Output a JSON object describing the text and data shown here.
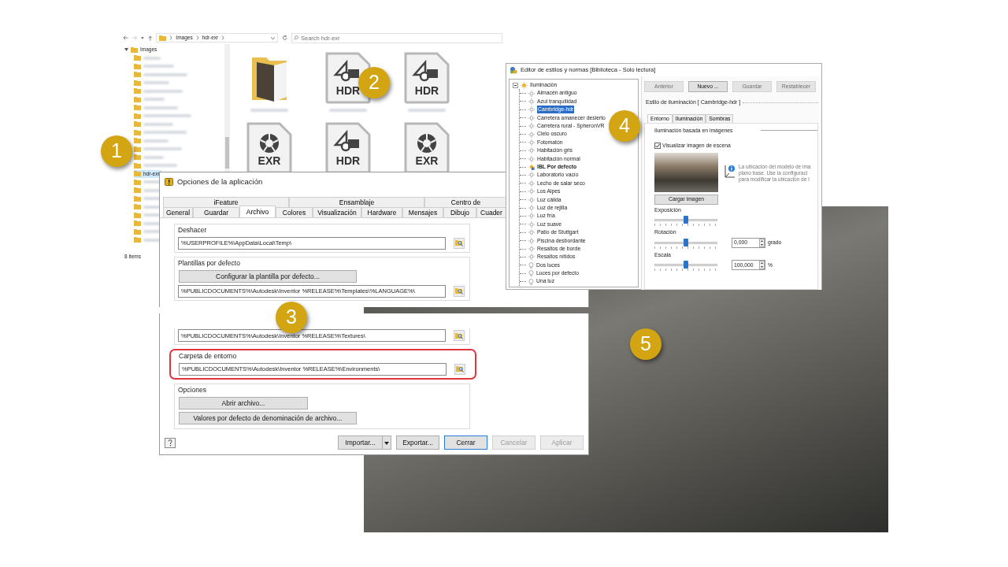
{
  "callouts": [
    "1",
    "2",
    "3",
    "4",
    "5"
  ],
  "explorer": {
    "breadcrumb": [
      "Images",
      "hdr-exr"
    ],
    "search": {
      "placeholder": "Search hdr-exr"
    },
    "tree": [
      {
        "label": "Images",
        "expanded": true,
        "children": [
          {
            "blurred": true,
            "selected": false
          },
          {
            "blurred": true,
            "selected": false
          },
          {
            "blurred": true,
            "selected": false
          },
          {
            "blurred": true,
            "selected": false
          },
          {
            "blurred": true,
            "selected": false
          },
          {
            "blurred": true,
            "selected": false
          },
          {
            "blurred": true,
            "selected": false
          },
          {
            "blurred": true,
            "selected": false
          },
          {
            "blurred": true,
            "selected": false
          },
          {
            "blurred": true,
            "selected": false
          },
          {
            "blurred": true,
            "selected": false
          },
          {
            "blurred": true,
            "selected": false
          },
          {
            "blurred": true,
            "selected": false
          },
          {
            "blurred": true,
            "selected": false
          },
          {
            "label": "hdr-exr",
            "blurred": false,
            "selected": true
          },
          {
            "blurred": true,
            "selected": false
          },
          {
            "blurred": true,
            "selected": false
          },
          {
            "blurred": true,
            "selected": false
          },
          {
            "blurred": true,
            "selected": false
          },
          {
            "blurred": true,
            "selected": false
          },
          {
            "blurred": true,
            "selected": false
          },
          {
            "blurred": true,
            "selected": false
          },
          {
            "blurred": true,
            "selected": false
          }
        ]
      }
    ],
    "status": "8 items",
    "files": [
      {
        "kind": "folder"
      },
      {
        "kind": "hdr",
        "label": "HDR"
      },
      {
        "kind": "hdr",
        "label": "HDR"
      },
      {
        "kind": "exr",
        "label": "EXR"
      },
      {
        "kind": "hdr",
        "label": "HDR"
      },
      {
        "kind": "exr",
        "label": "EXR"
      }
    ]
  },
  "options": {
    "title": "Opciones de la aplicación",
    "tab_rows": [
      [
        {
          "label": "iFeature",
          "selected": false
        },
        {
          "label": "Ensamblaje",
          "selected": false
        },
        {
          "label": "Centro de",
          "selected": false
        }
      ],
      [
        {
          "label": "General",
          "selected": false
        },
        {
          "label": "Guardar",
          "selected": false
        },
        {
          "label": "Archivo",
          "selected": true
        },
        {
          "label": "Colores",
          "selected": false
        },
        {
          "label": "Visualización",
          "selected": false
        },
        {
          "label": "Hardware",
          "selected": false
        },
        {
          "label": "Mensajes",
          "selected": false
        },
        {
          "label": "Dibujo",
          "selected": false
        },
        {
          "label": "Cuader",
          "selected": false
        }
      ]
    ],
    "upper_groups": [
      {
        "label": "Deshacer",
        "highlighted": false,
        "items": [
          {
            "kind": "path",
            "value": "%USERPROFILE%\\AppData\\Local\\Temp\\"
          }
        ]
      },
      {
        "label": "Plantillas por defecto",
        "highlighted": false,
        "items": [
          {
            "kind": "button",
            "label": "Configurar la plantilla por defecto..."
          },
          {
            "kind": "path",
            "value": "%PUBLICDOCUMENTS%\\Autodesk\\Inventor %RELEASE%\\Templates\\%LANGUAGE%\\"
          }
        ]
      }
    ],
    "lower_groups": [
      {
        "highlighted": false,
        "items": [
          {
            "kind": "path",
            "value": "%PUBLICDOCUMENTS%\\Autodesk\\Inventor %RELEASE%\\Textures\\"
          }
        ]
      },
      {
        "label": "Carpeta de entorno",
        "highlighted": true,
        "items": [
          {
            "kind": "path",
            "value": "%PUBLICDOCUMENTS%\\Autodesk\\Inventor %RELEASE%\\Environments\\"
          }
        ]
      },
      {
        "label": "Opciones",
        "highlighted": false,
        "items": [
          {
            "kind": "button",
            "label": "Abrir archivo..."
          },
          {
            "kind": "button",
            "label": "Valores por defecto de denominación de archivo..."
          }
        ]
      }
    ],
    "footer": [
      {
        "label": "Importar...",
        "kind": "split",
        "disabled": false,
        "default": false
      },
      {
        "label": "Exportar...",
        "kind": "plain",
        "disabled": false,
        "default": false
      },
      {
        "label": "Cerrar",
        "kind": "plain",
        "disabled": false,
        "default": true
      },
      {
        "label": "Cancelar",
        "kind": "plain",
        "disabled": true,
        "default": false
      },
      {
        "label": "Aplicar",
        "kind": "plain",
        "disabled": true,
        "default": false
      }
    ]
  },
  "editor": {
    "title": "Editor de estilos y normas [Biblioteca - Solo lectura]",
    "tree": {
      "label": "Iluminación",
      "expanded": true,
      "children": [
        {
          "label": "Almacén antiguo",
          "kind": "environment",
          "selected": false
        },
        {
          "label": "Azul tranquilidad",
          "kind": "environment",
          "selected": false
        },
        {
          "label": "Cambridge-hdr",
          "kind": "environment",
          "selected": true
        },
        {
          "label": "Carretera amanecer desierto",
          "kind": "environment",
          "selected": false
        },
        {
          "label": "Carretera rural - SpheronVR",
          "kind": "environment",
          "selected": false
        },
        {
          "label": "Cielo oscuro",
          "kind": "environment",
          "selected": false
        },
        {
          "label": "Fotomatón",
          "kind": "environment",
          "selected": false
        },
        {
          "label": "Habitación gris",
          "kind": "environment",
          "selected": false
        },
        {
          "label": "Habitación normal",
          "kind": "environment",
          "selected": false
        },
        {
          "label": "IBL Por defecto",
          "kind": "default",
          "selected": false
        },
        {
          "label": "Laboratorio vacío",
          "kind": "environment",
          "selected": false
        },
        {
          "label": "Lecho de salar seco",
          "kind": "environment",
          "selected": false
        },
        {
          "label": "Los Alpes",
          "kind": "environment",
          "selected": false
        },
        {
          "label": "Luz cálida",
          "kind": "environment",
          "selected": false
        },
        {
          "label": "Luz de rejilla",
          "kind": "environment",
          "selected": false
        },
        {
          "label": "Luz fría",
          "kind": "environment",
          "selected": false
        },
        {
          "label": "Luz suave",
          "kind": "environment",
          "selected": false
        },
        {
          "label": "Patio de Stuttgart",
          "kind": "environment",
          "selected": false
        },
        {
          "label": "Piscina desbordante",
          "kind": "environment",
          "selected": false
        },
        {
          "label": "Resaltos de borde",
          "kind": "environment",
          "selected": false
        },
        {
          "label": "Resaltos nítidos",
          "kind": "environment",
          "selected": false
        },
        {
          "label": "Dos luces",
          "kind": "light",
          "selected": false
        },
        {
          "label": "Luces por defecto",
          "kind": "light",
          "selected": false
        },
        {
          "label": "Una luz",
          "kind": "light",
          "selected": false
        }
      ]
    },
    "buttons": [
      {
        "label": "Anterior",
        "disabled": true
      },
      {
        "label": "Nuevo ...",
        "disabled": false
      },
      {
        "label": "Guardar",
        "disabled": true
      },
      {
        "label": "Restablecer",
        "disabled": true
      }
    ],
    "style_title": "Estilo de iluminación [ Cambridge-hdr ]",
    "tabs": [
      {
        "label": "Entorno",
        "selected": true
      },
      {
        "label": "Iluminación",
        "selected": false
      },
      {
        "label": "Sombras",
        "selected": false
      }
    ],
    "section": "Iluminación basada en imágenes",
    "show_scene": {
      "label": "Visualizar imagen de escena",
      "checked": true
    },
    "info_lines": [
      "La ubicación del modelo de ima",
      "plano base. Use la configuraci",
      "para modificar la ubicación de l"
    ],
    "load_button": "Cargar imagen",
    "sliders": [
      {
        "label": "Exposición",
        "level": 0.5
      },
      {
        "label": "Rotación",
        "level": 0.5,
        "value": "0,000",
        "unit": "grado"
      },
      {
        "label": "Escala",
        "level": 0.5,
        "value": "100,000",
        "unit": "%"
      }
    ]
  }
}
